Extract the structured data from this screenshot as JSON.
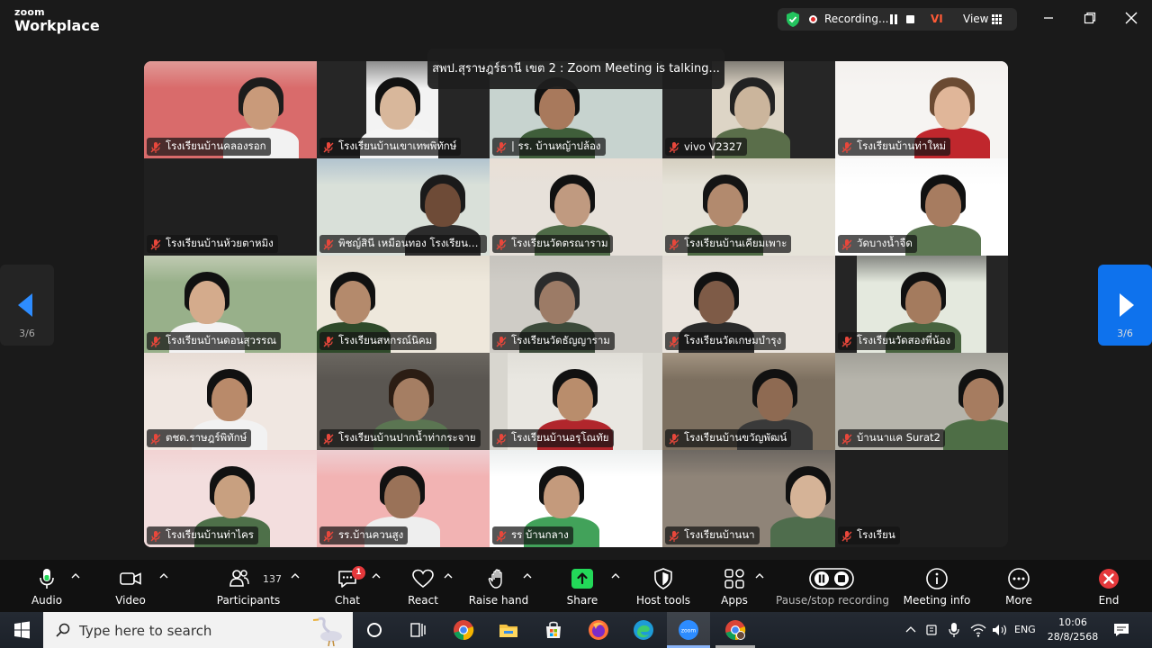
{
  "app": {
    "brand_top": "zoom",
    "brand_bottom": "Workplace",
    "recording_label": "Recording...",
    "user_initials": "VI",
    "view_label": "View"
  },
  "banner": {
    "text": "สพป.สุราษฎร์ธานี เขต 2 : Zoom Meeting is talking..."
  },
  "pager": {
    "left_label": "3/6",
    "right_label": "3/6"
  },
  "participants": [
    "โรงเรียนบ้านคลองรอก",
    "โรงเรียนบ้านเขาเทพพิทักษ์",
    "| รร. บ้านหญ้าปล้อง",
    "vivo V2327",
    "โรงเรียนบ้านท่าใหม่",
    "โรงเรียนบ้านห้วยตาหมิง",
    "พิชญ์สินี  เหมือนทอง โรงเรียนวัดส...",
    "โรงเรียนวัดตรณาราม",
    "โรงเรียนบ้านเคียมเพาะ",
    "วัดบางน้ำจืด",
    "โรงเรียนบ้านดอนสุวรรณ",
    "โรงเรียนสหกรณ์นิคม",
    "โรงเรียนวัดธัญญาราม",
    "โรงเรียนวัดเกษมบำรุง",
    "โรงเรียนวัดสองพี่น้อง",
    "ตชด.ราษฎร์พิทักษ์",
    "โรงเรียนบ้านปากน้ำท่ากระจาย",
    "โรงเรียนบ้านอรุโณทัย",
    "โรงเรียนบ้านขวัญพัฒน์",
    "บ้านนาแค Surat2",
    "โรงเรียนบ้านท่าไคร",
    "รร.บ้านควนสูง",
    "รร บ้านกลาง",
    "โรงเรียนบ้านนา",
    "โรงเรียน"
  ],
  "toolbar": {
    "audio": "Audio",
    "video": "Video",
    "participants": "Participants",
    "participants_count": "137",
    "chat": "Chat",
    "chat_badge": "1",
    "react": "React",
    "raise_hand": "Raise hand",
    "share": "Share",
    "host_tools": "Host tools",
    "apps": "Apps",
    "pause_stop_recording": "Pause/stop recording",
    "meeting_info": "Meeting info",
    "more": "More",
    "end": "End"
  },
  "taskbar": {
    "search_placeholder": "Type here to search",
    "language": "ENG",
    "time": "10:06",
    "date": "28/8/2568"
  },
  "colors": {
    "accent_blue": "#0e72ed",
    "share_green": "#23d959",
    "end_red": "#e5383b",
    "muted_red": "#e8473b"
  }
}
